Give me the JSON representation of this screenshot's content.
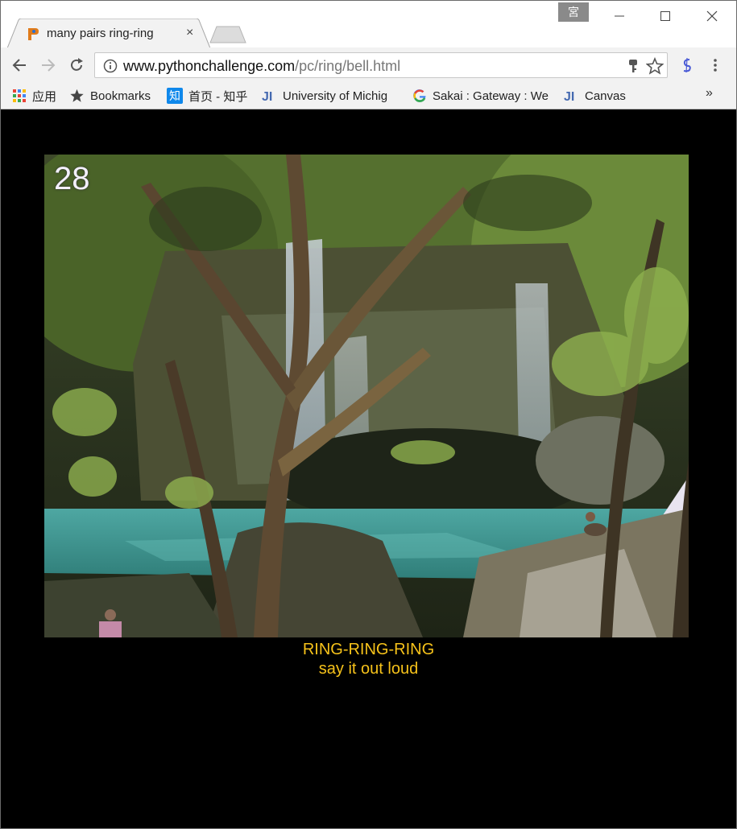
{
  "browser": {
    "ime_indicator": "宮",
    "tab": {
      "title": "many pairs ring-ring",
      "close": "×"
    },
    "address": {
      "host": "www.pythonchallenge.com",
      "path": "/pc/ring/bell.html"
    },
    "bookmarks": [
      {
        "label": "应用",
        "icon": "apps-grid-icon"
      },
      {
        "label": "Bookmarks",
        "icon": "star-icon"
      },
      {
        "label": "首页 - 知乎",
        "icon": "zhihu-icon"
      },
      {
        "label": "University of Michig",
        "icon": "ji-icon"
      },
      {
        "label": "Sakai : Gateway : We",
        "icon": "google-icon"
      },
      {
        "label": "Canvas",
        "icon": "ji-icon"
      }
    ],
    "bookmarks_more": "»"
  },
  "page": {
    "level_number": "28",
    "caption_line1": "RING-RING-RING",
    "caption_line2": "say it out loud",
    "caption_color": "#f6c21a",
    "background": "#000000"
  }
}
